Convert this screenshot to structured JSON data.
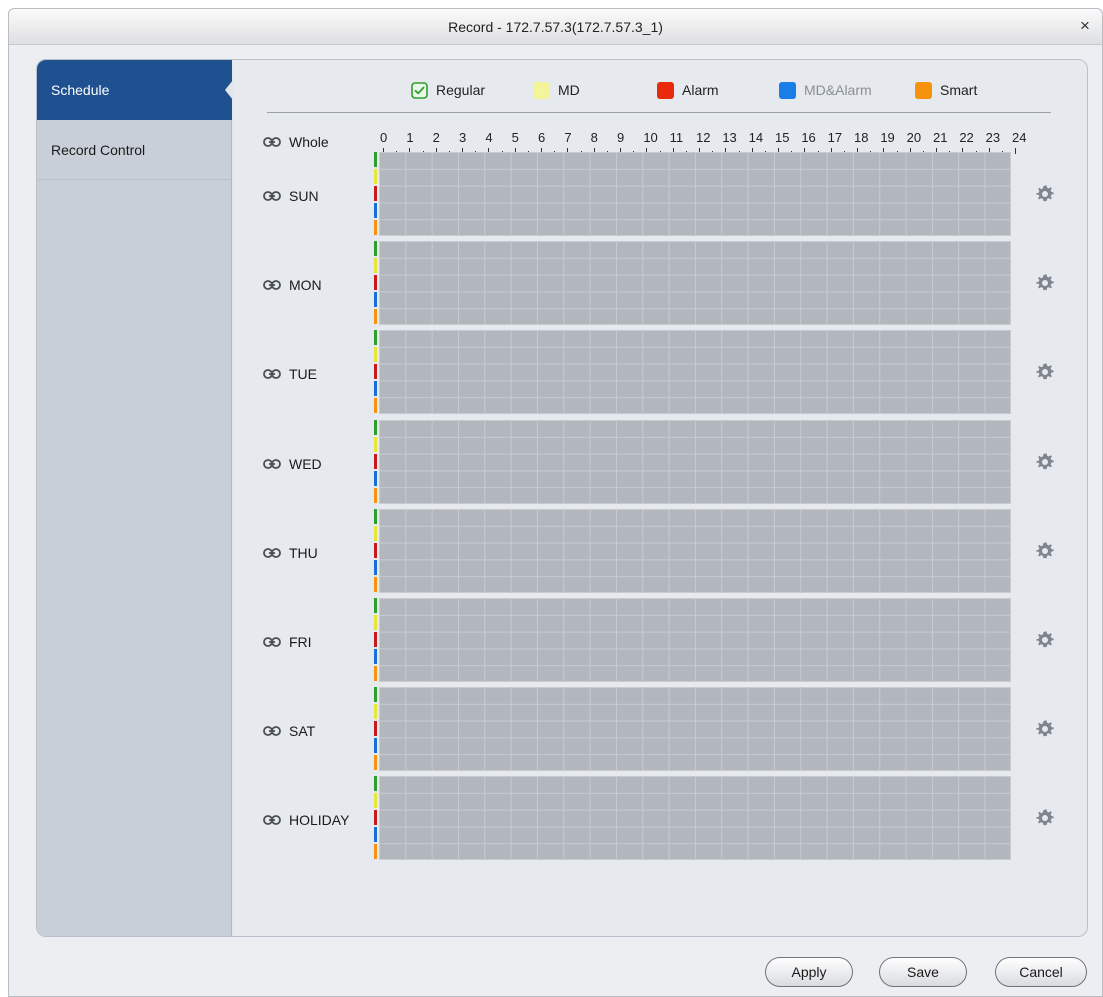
{
  "window": {
    "title": "Record - 172.7.57.3(172.7.57.3_1)",
    "close_glyph": "×"
  },
  "sidebar": {
    "items": [
      {
        "label": "Schedule",
        "active": true
      },
      {
        "label": "Record Control",
        "active": false
      }
    ]
  },
  "legend": {
    "items": [
      {
        "label": "Regular",
        "color": "#2e9e2e",
        "checked": true
      },
      {
        "label": "MD",
        "color": "#f4f59a"
      },
      {
        "label": "Alarm",
        "color": "#e8290b"
      },
      {
        "label": "MD&Alarm",
        "color": "#1a7ee8",
        "dimmed": true
      },
      {
        "label": "Smart",
        "color": "#f7920d"
      }
    ]
  },
  "timeline": {
    "whole_label": "Whole",
    "hours": [
      "0",
      "1",
      "2",
      "3",
      "4",
      "5",
      "6",
      "7",
      "8",
      "9",
      "10",
      "11",
      "12",
      "13",
      "14",
      "15",
      "16",
      "17",
      "18",
      "19",
      "20",
      "21",
      "22",
      "23",
      "24"
    ]
  },
  "days": [
    {
      "label": "SUN"
    },
    {
      "label": "MON"
    },
    {
      "label": "TUE"
    },
    {
      "label": "WED"
    },
    {
      "label": "THU"
    },
    {
      "label": "FRI"
    },
    {
      "label": "SAT"
    },
    {
      "label": "HOLIDAY"
    }
  ],
  "record_type_strip_colors": [
    "#2e9e2e",
    "#e6e63a",
    "#c81a1a",
    "#1a6ed8",
    "#f7920d"
  ],
  "buttons": {
    "apply": "Apply",
    "save": "Save",
    "cancel": "Cancel"
  },
  "icons": {
    "link": "link-icon",
    "gear": "gear-icon",
    "check": "check-icon"
  }
}
